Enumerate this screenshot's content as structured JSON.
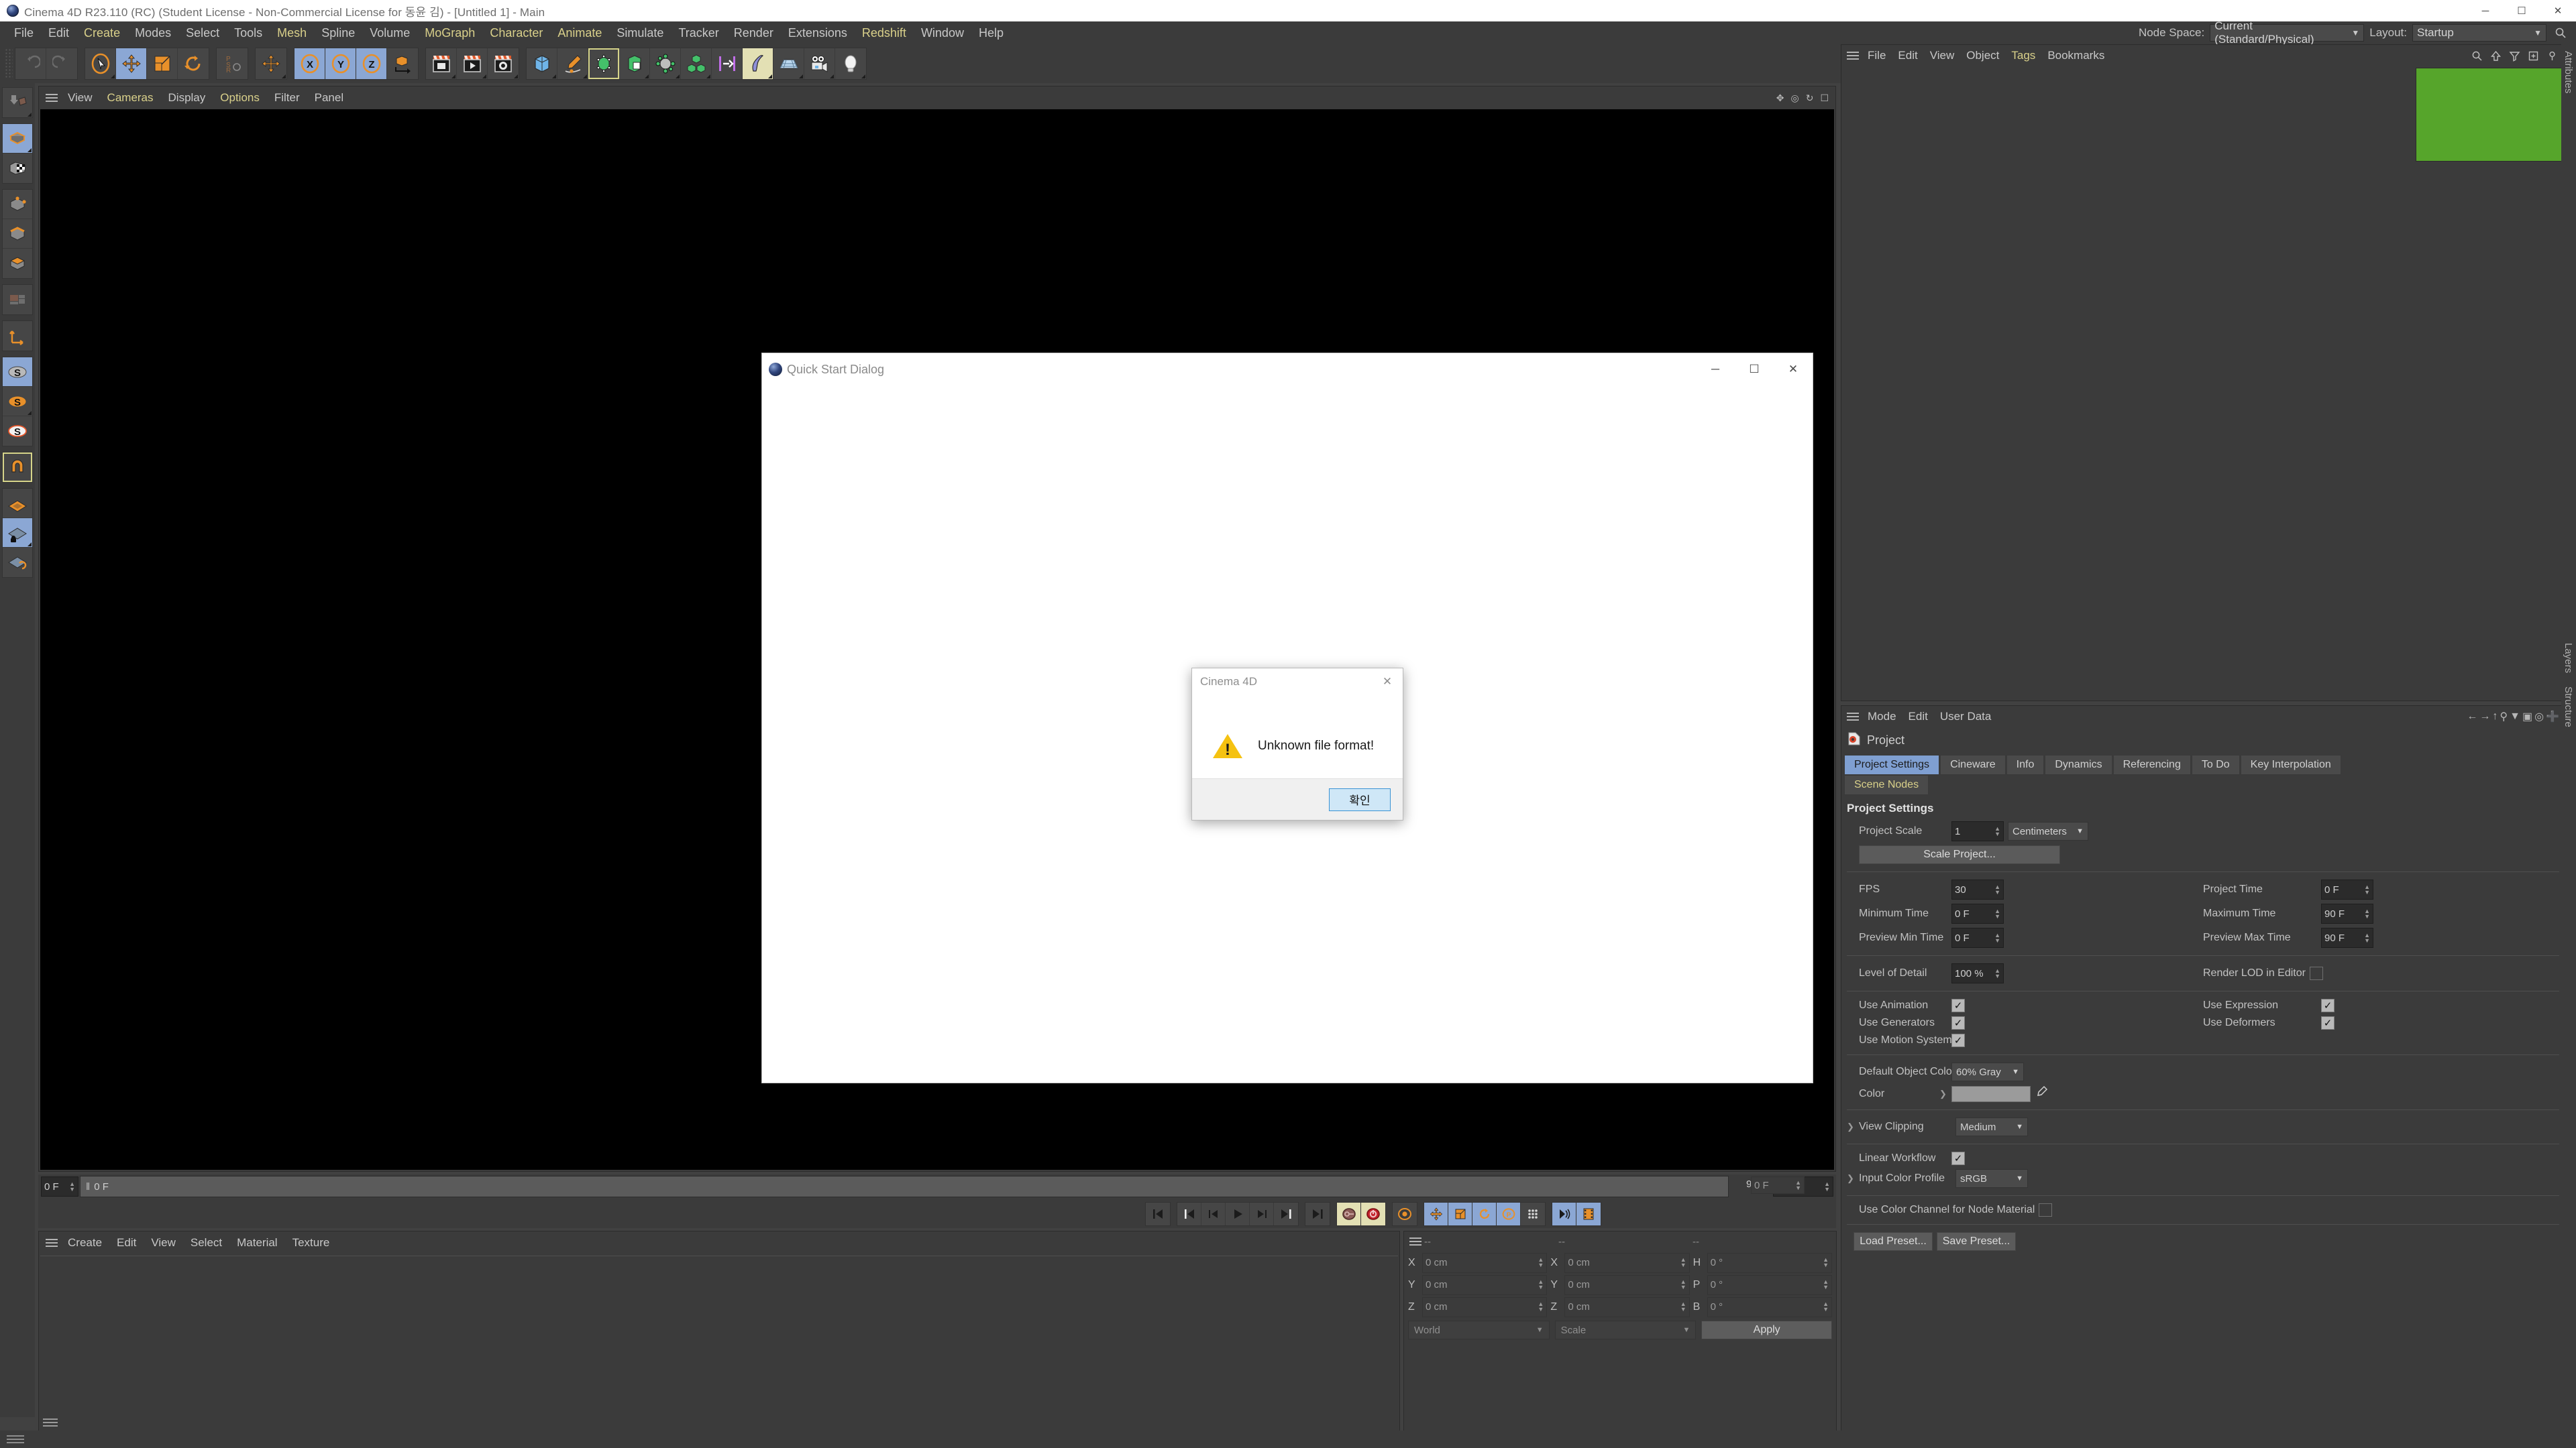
{
  "window": {
    "title": "Cinema 4D R23.110 (RC) (Student License - Non-Commercial License for 동윤 김) - [Untitled 1] - Main",
    "minimize": "─",
    "maximize": "☐",
    "close": "✕"
  },
  "menubar": {
    "items": [
      {
        "label": "File",
        "hl": false
      },
      {
        "label": "Edit",
        "hl": false
      },
      {
        "label": "Create",
        "hl": true
      },
      {
        "label": "Modes",
        "hl": false
      },
      {
        "label": "Select",
        "hl": false
      },
      {
        "label": "Tools",
        "hl": false
      },
      {
        "label": "Mesh",
        "hl": true
      },
      {
        "label": "Spline",
        "hl": false
      },
      {
        "label": "Volume",
        "hl": false
      },
      {
        "label": "MoGraph",
        "hl": true
      },
      {
        "label": "Character",
        "hl": true
      },
      {
        "label": "Animate",
        "hl": true
      },
      {
        "label": "Simulate",
        "hl": false
      },
      {
        "label": "Tracker",
        "hl": false
      },
      {
        "label": "Render",
        "hl": false
      },
      {
        "label": "Extensions",
        "hl": false
      },
      {
        "label": "Redshift",
        "hl": true
      },
      {
        "label": "Window",
        "hl": false
      },
      {
        "label": "Help",
        "hl": false
      }
    ]
  },
  "topright": {
    "node_space_label": "Node Space:",
    "node_space_value": "Current (Standard/Physical)",
    "layout_label": "Layout:",
    "layout_value": "Startup",
    "search_icon": "search-icon"
  },
  "viewport": {
    "menu": [
      {
        "label": "View",
        "hl": false
      },
      {
        "label": "Cameras",
        "hl": true
      },
      {
        "label": "Display",
        "hl": false
      },
      {
        "label": "Options",
        "hl": true
      },
      {
        "label": "Filter",
        "hl": false
      },
      {
        "label": "Panel",
        "hl": false
      }
    ]
  },
  "timeline": {
    "current_frame": "0 F",
    "track_start": "0 F",
    "range_end_ghost": "90 F",
    "range_end": "90 F",
    "right_frame": "0 F"
  },
  "material_manager": {
    "menu": [
      "Create",
      "Edit",
      "View",
      "Select",
      "Material",
      "Texture"
    ]
  },
  "coordinates": {
    "header": [
      "--",
      "--",
      "--"
    ],
    "rows": [
      {
        "axis": "X",
        "pos": "0 cm",
        "axis2": "X",
        "size": "0 cm",
        "axis3": "H",
        "rot": "0 °"
      },
      {
        "axis": "Y",
        "pos": "0 cm",
        "axis2": "Y",
        "size": "0 cm",
        "axis3": "P",
        "rot": "0 °"
      },
      {
        "axis": "Z",
        "pos": "0 cm",
        "axis2": "Z",
        "size": "0 cm",
        "axis3": "B",
        "rot": "0 °"
      }
    ],
    "system": "World",
    "mode": "Scale",
    "apply": "Apply"
  },
  "object_manager": {
    "menu": [
      {
        "label": "File",
        "hl": false
      },
      {
        "label": "Edit",
        "hl": false
      },
      {
        "label": "View",
        "hl": false
      },
      {
        "label": "Object",
        "hl": false
      },
      {
        "label": "Tags",
        "hl": true
      },
      {
        "label": "Bookmarks",
        "hl": false
      }
    ],
    "icons": [
      "search-icon",
      "up-arrow-icon",
      "filter-icon",
      "add-box-icon",
      "object-toggle-icon"
    ],
    "thumbnail_color": "#56a52b"
  },
  "attribute_manager": {
    "menu": [
      "Mode",
      "Edit",
      "User Data"
    ],
    "object_name": "Project",
    "tabs": [
      {
        "label": "Project Settings",
        "active": true,
        "yellow": false
      },
      {
        "label": "Cineware",
        "active": false,
        "yellow": false
      },
      {
        "label": "Info",
        "active": false,
        "yellow": false
      },
      {
        "label": "Dynamics",
        "active": false,
        "yellow": false
      },
      {
        "label": "Referencing",
        "active": false,
        "yellow": false
      },
      {
        "label": "To Do",
        "active": false,
        "yellow": false
      },
      {
        "label": "Key Interpolation",
        "active": false,
        "yellow": false
      }
    ],
    "tabs_row2": [
      {
        "label": "Scene Nodes",
        "active": false,
        "yellow": true
      }
    ],
    "section_title": "Project Settings",
    "project_scale_label": "Project Scale",
    "project_scale_value": "1",
    "project_scale_unit": "Centimeters",
    "scale_project_button": "Scale Project...",
    "fps_label": "FPS",
    "fps_value": "30",
    "project_time_label": "Project Time",
    "project_time_value": "0 F",
    "minimum_time_label": "Minimum Time",
    "minimum_time_value": "0 F",
    "maximum_time_label": "Maximum Time",
    "maximum_time_value": "90 F",
    "preview_min_label": "Preview Min Time",
    "preview_min_value": "0 F",
    "preview_max_label": "Preview Max Time",
    "preview_max_value": "90 F",
    "lod_label": "Level of Detail",
    "lod_value": "100 %",
    "render_lod_label": "Render LOD in Editor",
    "render_lod_checked": false,
    "use_animation_label": "Use Animation",
    "use_animation_checked": true,
    "use_expression_label": "Use Expression",
    "use_expression_checked": true,
    "use_generators_label": "Use Generators",
    "use_generators_checked": true,
    "use_deformers_label": "Use Deformers",
    "use_deformers_checked": true,
    "use_motion_label": "Use Motion System",
    "use_motion_checked": true,
    "default_object_color_label": "Default Object Color",
    "default_object_color_value": "60% Gray",
    "color_label": "Color",
    "color_swatch": "#9b9b9b",
    "view_clipping_label": "View Clipping",
    "view_clipping_value": "Medium",
    "linear_workflow_label": "Linear Workflow",
    "linear_workflow_checked": true,
    "input_color_profile_label": "Input Color Profile",
    "input_color_profile_value": "sRGB",
    "node_material_label": "Use Color Channel for Node Material",
    "node_material_checked": false,
    "load_preset": "Load Preset...",
    "save_preset": "Save Preset..."
  },
  "side_tabs": [
    "Attributes",
    "Layers",
    "Structure"
  ],
  "quick_start_dialog": {
    "title": "Quick Start Dialog",
    "minimize": "─",
    "maximize": "☐",
    "close": "✕"
  },
  "alert": {
    "title": "Cinema 4D",
    "close": "✕",
    "icon": "warning-triangle-icon",
    "message": "Unknown file format!",
    "ok_button": "확인"
  }
}
